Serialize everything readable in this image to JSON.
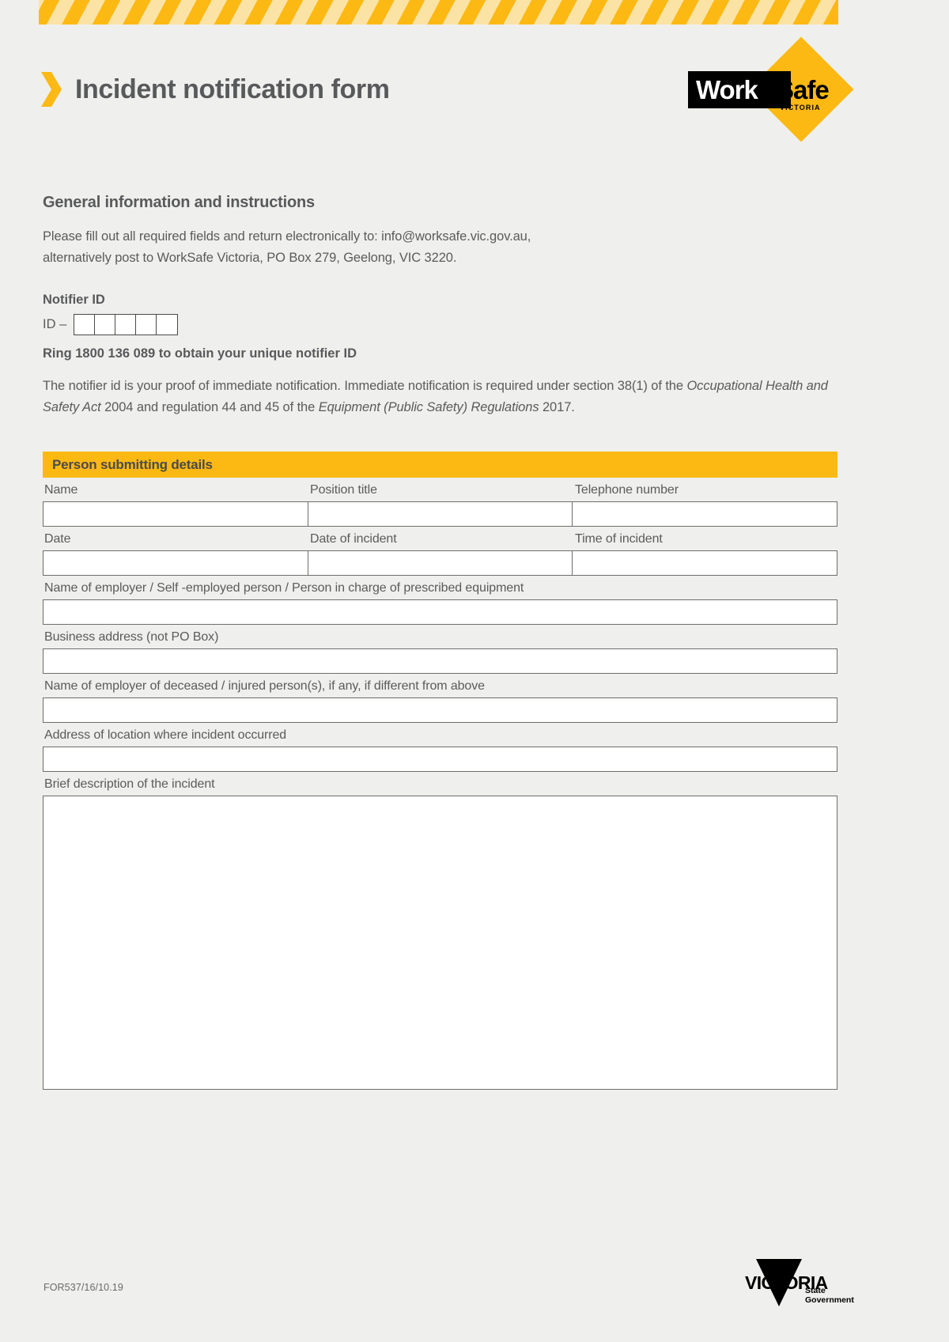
{
  "document": {
    "title": "Incident notification form",
    "footer_code": "FOR537/16/10.19"
  },
  "brand": {
    "worksafe_work": "Work",
    "worksafe_safe": "Safe",
    "worksafe_state": "VICTORIA",
    "victoria_word": "VICTORIA",
    "victoria_sub_line1": "State",
    "victoria_sub_line2": "Government",
    "accent_yellow": "#fdb913",
    "text_grey": "#58595b",
    "page_background": "#efefed"
  },
  "general": {
    "heading": "General information and instructions",
    "instructions_line1": "Please fill out all required fields and return electronically to: info@worksafe.vic.gov.au,",
    "instructions_line2": "alternatively post to WorkSafe Victoria, PO Box 279, Geelong, VIC 3220."
  },
  "notifier": {
    "heading": "Notifier ID",
    "id_prefix": "ID  –",
    "box_count": 5,
    "ring_line": "Ring 1800 136 089 to obtain your unique notifier ID",
    "proof_part1": "The notifier id is your proof of immediate notification. Immediate notification is required under section 38(1) of the ",
    "proof_italic1": "Occupational Health and Safety Act",
    "proof_part2": " 2004 and regulation 44 and 45 of the ",
    "proof_italic2": "Equipment (Public Safety) Regulations",
    "proof_part3": " 2017."
  },
  "person_section": {
    "banner_label": "Person submitting details",
    "row1": {
      "labels": [
        "Name",
        "Position title",
        "Telephone number"
      ],
      "values": [
        "",
        "",
        ""
      ]
    },
    "row2": {
      "labels": [
        "Date",
        "Date of incident",
        "Time of incident"
      ],
      "values": [
        "",
        "",
        ""
      ]
    },
    "fields": [
      {
        "label": "Name of employer / Self -employed person / Person in charge of prescribed equipment",
        "value": "",
        "type": "text"
      },
      {
        "label": "Business address (not PO Box)",
        "value": "",
        "type": "text"
      },
      {
        "label": "Name of employer of deceased / injured person(s), if any, if different from above",
        "value": "",
        "type": "text"
      },
      {
        "label": "Address of location where incident occurred",
        "value": "",
        "type": "text"
      },
      {
        "label": "Brief description of the incident",
        "value": "",
        "type": "textarea"
      }
    ]
  }
}
